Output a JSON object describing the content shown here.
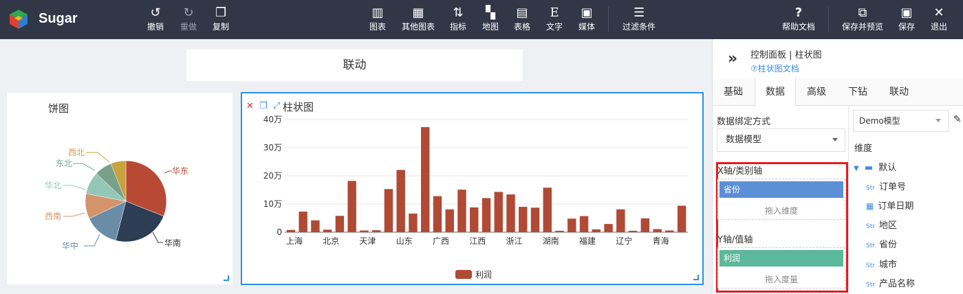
{
  "app": {
    "name": "Sugar"
  },
  "toolbar": {
    "undo": "撤销",
    "redo": "重做",
    "copy": "复制",
    "chart": "图表",
    "other_charts": "其他图表",
    "indicator": "指标",
    "map": "地图",
    "table": "表格",
    "text": "文字",
    "media": "媒体",
    "filter": "过滤条件",
    "help": "帮助文档",
    "save_preview": "保存并预览",
    "save": "保存",
    "exit": "退出"
  },
  "canvas": {
    "linkage_title": "联动",
    "pie_title": "饼图",
    "bar_title": "柱状图"
  },
  "pie_labels": {
    "east": "华东",
    "south": "华南",
    "central": "华中",
    "southwest": "西南",
    "north": "华北",
    "northeast": "东北",
    "northwest": "西北"
  },
  "bar_text": {
    "y_ticks": [
      "0",
      "10万",
      "20万",
      "30万",
      "40万"
    ],
    "x_ticks": [
      "上海",
      "北京",
      "天津",
      "山东",
      "广西",
      "江西",
      "浙江",
      "湖南",
      "福建",
      "辽宁",
      "青海"
    ],
    "legend": "利润"
  },
  "panel": {
    "title": "控制面板 | 柱状图",
    "doc_link": "⑦柱状图文档",
    "tabs": [
      "基础",
      "数据",
      "高级",
      "下钻",
      "联动"
    ],
    "binding_label": "数据绑定方式",
    "binding_value": "数据模型",
    "x_axis_label": "X轴/类别轴",
    "x_axis_field": "省份",
    "x_axis_hint": "拖入维度",
    "y_axis_label": "Y轴/值轴",
    "y_axis_field": "利润",
    "y_axis_hint": "拖入度量",
    "model": "Demo模型",
    "dimension_label": "维度",
    "folder": "默认",
    "fields": [
      "订单号",
      "订单日期",
      "地区",
      "省份",
      "城市",
      "产品名称"
    ],
    "str_tag": "Str"
  },
  "colors": {
    "toolbar_bg": "#323747",
    "accent": "#2a8fe8",
    "highlight": "#e8191c",
    "dimension_chip": "#5b8fd6",
    "measure_chip": "#5cb89a",
    "bar": "#b04a35"
  },
  "chart_data": [
    {
      "type": "pie",
      "title": "饼图",
      "slices": [
        {
          "name": "华东",
          "value": 31,
          "color": "#b84a35"
        },
        {
          "name": "华南",
          "value": 23,
          "color": "#2d3d54"
        },
        {
          "name": "华中",
          "value": 14,
          "color": "#6a8ca6"
        },
        {
          "name": "西南",
          "value": 10,
          "color": "#d3936b"
        },
        {
          "name": "华北",
          "value": 9,
          "color": "#95c7b8"
        },
        {
          "name": "东北",
          "value": 7,
          "color": "#78a08b"
        },
        {
          "name": "西北",
          "value": 6,
          "color": "#c9a23e"
        }
      ]
    },
    {
      "type": "bar",
      "title": "柱状图",
      "ylim": [
        0,
        400000
      ],
      "y_ticks": [
        0,
        100000,
        200000,
        300000,
        400000
      ],
      "series": [
        {
          "name": "利润",
          "values": [
            8000,
            73000,
            42000,
            9000,
            58000,
            182000,
            6000,
            7000,
            153000,
            221000,
            66000,
            373000,
            128000,
            81000,
            151000,
            88000,
            121000,
            143000,
            134000,
            90000,
            87000,
            158000,
            5000,
            48000,
            57000,
            10000,
            29000,
            81000,
            5000,
            49000,
            11000,
            6000,
            94000
          ]
        }
      ]
    }
  ]
}
